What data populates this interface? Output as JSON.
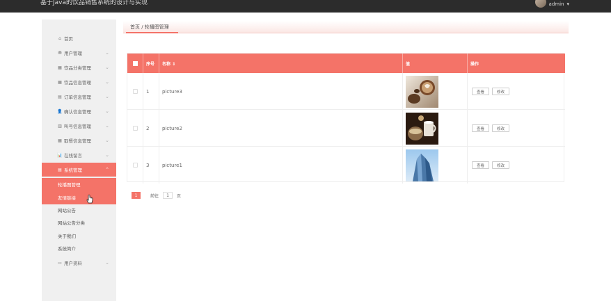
{
  "header": {
    "title": "基于Java的饮品销售系统的设计与实现",
    "username": "admin",
    "user_caret": "▾"
  },
  "sidebar": {
    "items": [
      {
        "label": "首页",
        "icon": "⌂"
      },
      {
        "label": "用户管理",
        "icon": "⛃"
      },
      {
        "label": "饮品分类管理",
        "icon": "▦"
      },
      {
        "label": "饮品信息管理",
        "icon": "▦"
      },
      {
        "label": "订单信息管理",
        "icon": "▤"
      },
      {
        "label": "确认信息管理",
        "icon": "👤"
      },
      {
        "label": "叫号信息管理",
        "icon": "▥"
      },
      {
        "label": "取餐信息管理",
        "icon": "▦"
      },
      {
        "label": "在线留言",
        "icon": "📊"
      },
      {
        "label": "系统管理",
        "icon": "▤"
      }
    ],
    "system_submenu": [
      "轮播图管理",
      "友情链接",
      "网站公告",
      "网站公告分类",
      "关于我们",
      "系统简介"
    ],
    "last_item": {
      "label": "用户资料",
      "icon": "▭"
    }
  },
  "breadcrumb": "首页 / 轮播图管理",
  "table": {
    "headers": [
      "序号",
      "名称 ⇕",
      "值",
      "操作"
    ],
    "rows": [
      {
        "index": "1",
        "name": "picture3",
        "image": "latte-art"
      },
      {
        "index": "2",
        "name": "picture2",
        "image": "coffee-cup"
      },
      {
        "index": "3",
        "name": "picture1",
        "image": "glass-building"
      }
    ],
    "actions": {
      "view": "查看",
      "edit": "修改"
    }
  },
  "pagination": {
    "current": "1",
    "goto_label": "前往",
    "goto_value": "1",
    "page_unit": "页"
  },
  "colors": {
    "accent": "#f47368",
    "topbar": "#2c2c2c",
    "sidebar": "#f0f0f0"
  }
}
